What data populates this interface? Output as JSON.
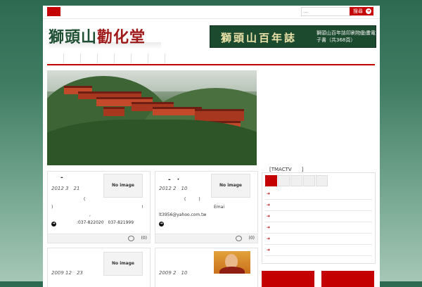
{
  "search": {
    "placeholder": "...",
    "button_label": "搜尋"
  },
  "header": {
    "logo_part1": "獅頭山",
    "logo_part2": "勸化堂",
    "banner_title": "獅頭山百年誌",
    "banner_text": "獅頭山百年誌印刷物動畫電子書（共368頁）"
  },
  "nav": {
    "item_count": 7
  },
  "sidebar": {
    "tmactv_label": "[TMACTV　　]"
  },
  "cards": [
    {
      "title": "-",
      "date": "2012 3　21",
      "no_image_label": "No image",
      "lines": [
        "(",
        ")　　　　　　　　　　　　　　　　　　　　　!",
        "　　　　　　　　　,",
        "　　　　　　:037-822020　037-821999"
      ],
      "comment_count": "(0)"
    },
    {
      "title": "-　·",
      "date": "2012 2　10",
      "no_image_label": "No image",
      "lines": [
        "(　　　)",
        "　　　　　　　　　　　　　Emai",
        "lt3956@yahoo.com.tw"
      ],
      "comment_count": "(0)"
    },
    {
      "title": "",
      "date": "2009 12　23",
      "no_image_label": "No image",
      "lines": [],
      "comment_count": ""
    },
    {
      "title": "",
      "date": "2009 2　10",
      "no_image_label": "",
      "lines": [],
      "comment_count": ""
    }
  ],
  "icons": {
    "more": "arrow-circle-icon",
    "comment": "speech-bubble-icon",
    "bullet": "arrow-bullet-icon"
  },
  "colors": {
    "accent": "#c40000",
    "brand_green": "#1f4f33"
  }
}
